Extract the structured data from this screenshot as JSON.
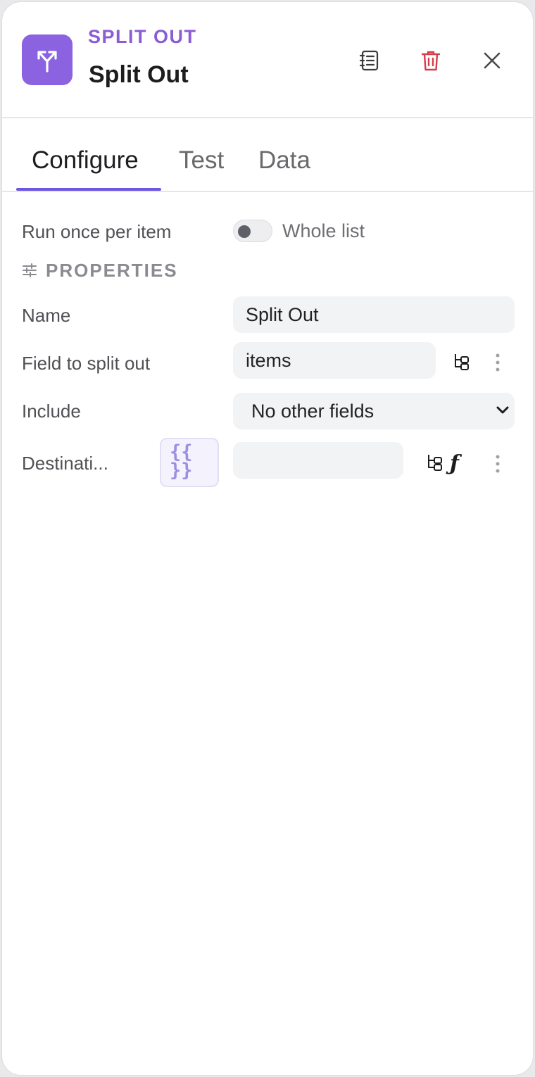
{
  "header": {
    "kicker": "SPLIT OUT",
    "title": "Split Out",
    "node_icon": "split-arrows-icon",
    "accent_color": "#8b62e0",
    "actions": [
      {
        "icon": "notes-icon"
      },
      {
        "icon": "trash-icon",
        "color": "#d43d4b"
      },
      {
        "icon": "close-icon"
      }
    ]
  },
  "tabs": [
    {
      "label": "Configure",
      "active": true
    },
    {
      "label": "Test",
      "active": false
    },
    {
      "label": "Data",
      "active": false
    }
  ],
  "run_mode": {
    "label": "Run once per item",
    "toggle_label": "Whole list",
    "toggle_on": false
  },
  "section": {
    "title": "PROPERTIES",
    "icon": "sliders-icon"
  },
  "fields": {
    "name": {
      "label": "Name",
      "value": "Split Out"
    },
    "field_to_split": {
      "label": "Field to split out",
      "value": "items"
    },
    "include": {
      "label": "Include",
      "value": "No other fields"
    },
    "destination": {
      "label": "Destinati...",
      "expression_badge": "{{\n}}",
      "value": ""
    }
  }
}
